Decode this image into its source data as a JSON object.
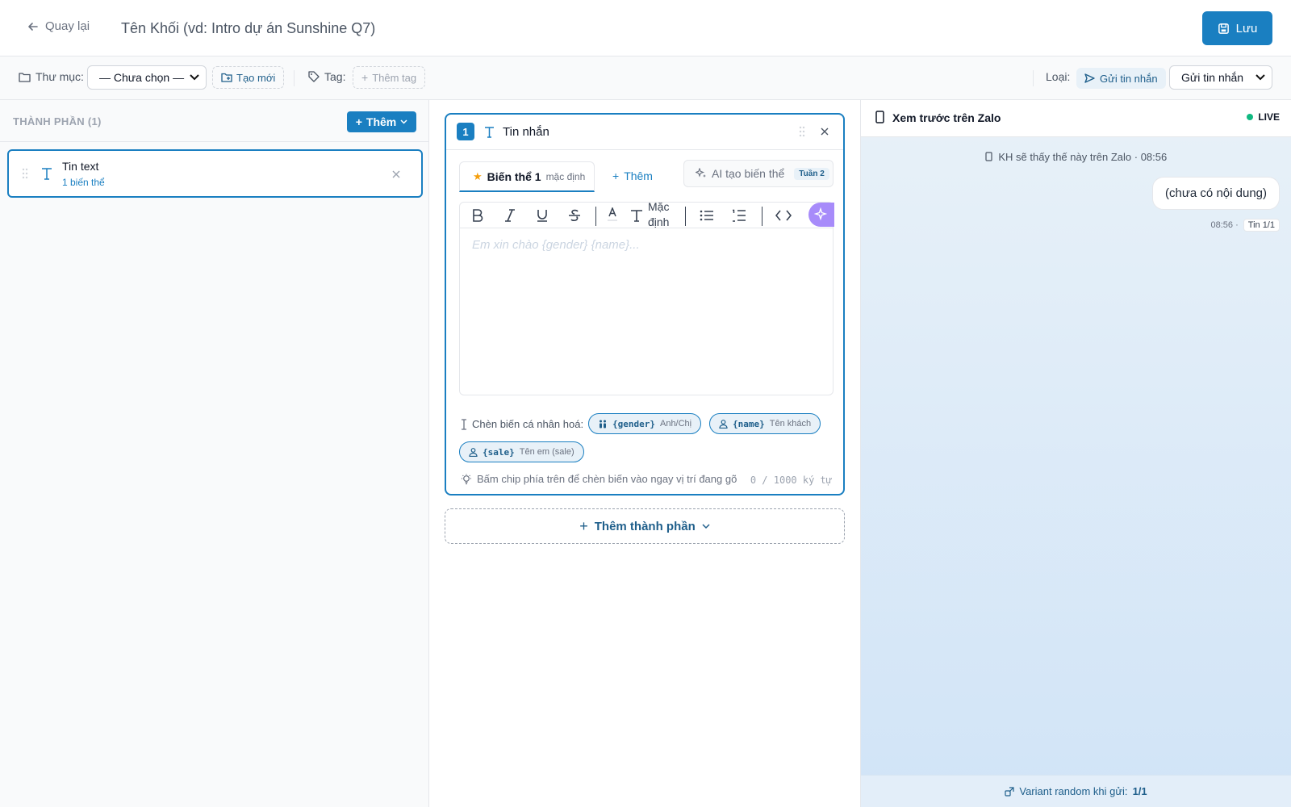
{
  "header": {
    "back_label": "Quay lại",
    "title_placeholder": "Tên Khối (vd: Intro dự án Sunshine Q7)",
    "save_label": "Lưu"
  },
  "toolbar": {
    "folder_label": "Thư mục:",
    "folder_selected": "— Chưa chọn —",
    "create_new_label": "Tạo mới",
    "tag_label": "Tag:",
    "add_tag_label": "Thêm tag",
    "type_label": "Loại:",
    "type_badge": "Gửi tin nhắn",
    "type_selected": "Gửi tin nhắn"
  },
  "components_panel": {
    "title": "THÀNH PHẦN (1)",
    "add_label": "Thêm",
    "items": [
      {
        "name": "Tin text",
        "subtitle": "1 biến thể"
      }
    ]
  },
  "editor": {
    "index": "1",
    "title": "Tin nhắn",
    "tab_label": "Biến thể 1",
    "tab_badge": "mặc định",
    "add_variant_label": "Thêm",
    "ai_label": "AI tạo biến thể",
    "ai_badge": "Tuần 2",
    "font_default_label": "Mặc định",
    "placeholder": "Em xin chào {gender} {name}...",
    "vars_label": "Chèn biến cá nhân hoá:",
    "chips": [
      {
        "code": "{gender}",
        "desc": "Anh/Chị"
      },
      {
        "code": "{name}",
        "desc": "Tên khách"
      },
      {
        "code": "{sale}",
        "desc": "Tên em (sale)"
      }
    ],
    "hint": "Bấm chip phía trên để chèn biến vào ngay vị trí đang gõ",
    "counter": "0 / 1000 ký tự",
    "add_component_label": "Thêm thành phần"
  },
  "preview": {
    "title": "Xem trước trên Zalo",
    "live_label": "LIVE",
    "note": "KH sẽ thấy thế này trên Zalo · 08:56",
    "bubble_text": "(chưa có nội dung)",
    "bubble_time": "08:56 ·",
    "bubble_tag": "Tin 1/1",
    "footer_label": "Variant random khi gửi:",
    "footer_value": "1/1"
  },
  "colors": {
    "primary": "#1a7fc1",
    "primary_soft": "#e8f1f8",
    "live": "#10b981",
    "star": "#f59e0b"
  }
}
